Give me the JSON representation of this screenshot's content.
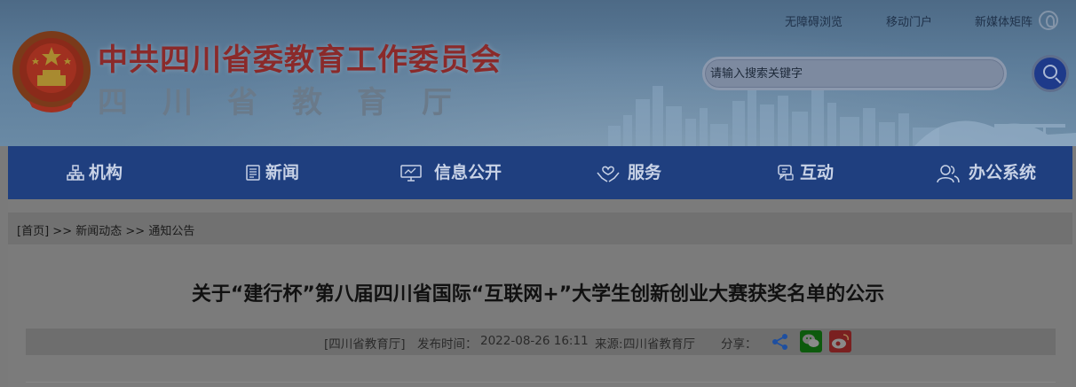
{
  "header": {
    "title_main": "中共四川省委教育工作委员会",
    "title_sub": "四川省教育厅",
    "top_links": [
      "无障碍浏览",
      "移动门户",
      "新媒体矩阵"
    ],
    "search": {
      "placeholder": "请输入搜索关键字"
    }
  },
  "nav": {
    "items": [
      {
        "label": "机构",
        "icon": "org-chart-icon"
      },
      {
        "label": "新闻",
        "icon": "news-icon"
      },
      {
        "label": "信息公开",
        "icon": "monitor-icon"
      },
      {
        "label": "服务",
        "icon": "hands-heart-icon"
      },
      {
        "label": "互动",
        "icon": "chat-icon"
      },
      {
        "label": "办公系统",
        "icon": "users-icon"
      }
    ]
  },
  "breadcrumb": {
    "items": [
      "[首页]",
      "新闻动态",
      "通知公告"
    ],
    "separator": ">>"
  },
  "article": {
    "title": "关于“建行杯”第八届四川省国际“互联网+”大学生创新创业大赛获奖名单的公示",
    "source_tag": "[四川省教育厅]",
    "publish_label": "发布时间：",
    "publish_time": "2022-08-26 16:11",
    "source_label": "来源:",
    "source": "四川省教育厅",
    "share_label": "分享："
  },
  "colors": {
    "nav_bg": "#1f3f7f",
    "title_red": "#8a2a2a",
    "search_btn": "#1e3a8a"
  }
}
